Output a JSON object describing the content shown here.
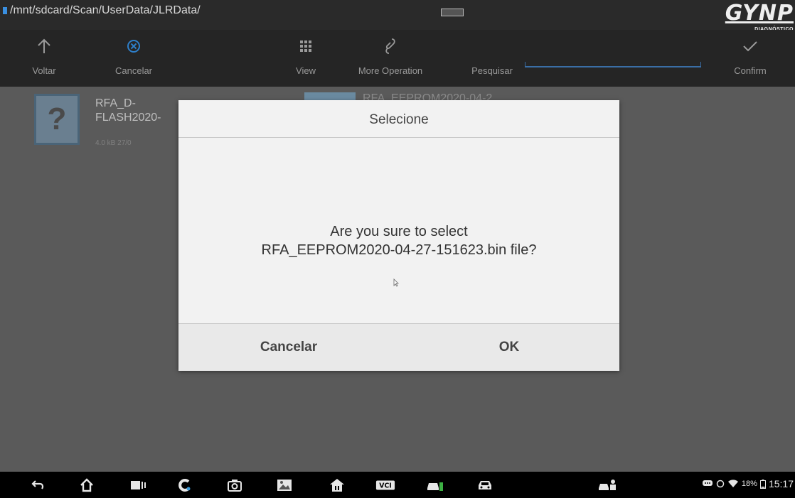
{
  "path": "/mnt/sdcard/Scan/UserData/JLRData/",
  "logo": {
    "brand": "GYNP",
    "sub": "DIAGNÓSTICO"
  },
  "toolbar": {
    "back_label": "Voltar",
    "cancel_label": "Cancelar",
    "view_label": "View",
    "more_label": "More Operation",
    "search_label": "Pesquisar",
    "confirm_label": "Confirm"
  },
  "files": [
    {
      "name": "RFA_D-FLASH2020-",
      "meta": "4.0 kB   27/0"
    },
    {
      "name": "RFA_EEPROM2020-04-2"
    }
  ],
  "dialog": {
    "title": "Selecione",
    "message_line1": "Are you sure to select",
    "message_line2": "RFA_EEPROM2020-04-27-151623.bin file?",
    "cancel": "Cancelar",
    "ok": "OK"
  },
  "status": {
    "battery": "18%",
    "time": "15:17"
  },
  "colors": {
    "accent": "#3a6ea5",
    "dialog_bg": "#f2f2f2",
    "toolbar_bg": "#252525"
  }
}
